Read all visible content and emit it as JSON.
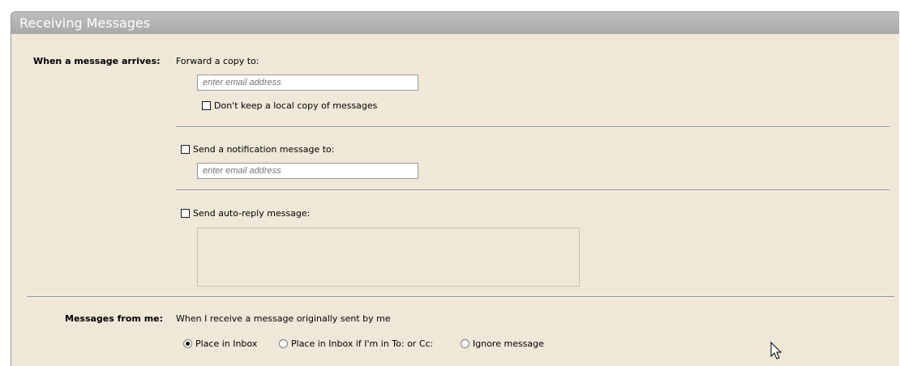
{
  "section": {
    "title": "Receiving Messages"
  },
  "arrival": {
    "label": "When a message arrives:",
    "forward_label": "Forward a copy to:",
    "forward_placeholder": "enter email address",
    "no_local_copy_label": "Don't keep a local copy of messages",
    "no_local_copy_checked": false,
    "notify_label": "Send a notification message to:",
    "notify_checked": false,
    "notify_placeholder": "enter email address",
    "autoreply_label": "Send auto-reply message:",
    "autoreply_checked": false,
    "autoreply_text": ""
  },
  "from_me": {
    "label": "Messages from me:",
    "description": "When I receive a message originally sent by me",
    "options": [
      {
        "label": "Place in Inbox",
        "checked": true
      },
      {
        "label": "Place in Inbox if I'm in To: or Cc:",
        "checked": false
      },
      {
        "label": "Ignore message",
        "checked": false
      }
    ]
  }
}
